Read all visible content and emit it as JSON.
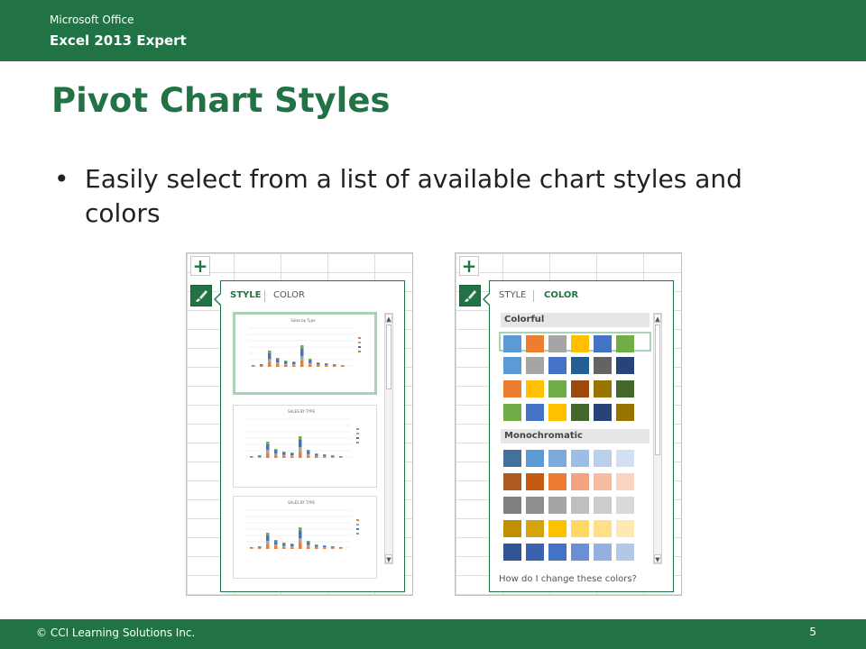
{
  "header": {
    "brand": "Microsoft Office",
    "product": "Excel 2013 Expert",
    "bg_color": "#217346"
  },
  "slide": {
    "title": "Pivot Chart Styles",
    "bullet_symbol": "•",
    "bullets": [
      "Easily select from a list of available chart styles and colors"
    ]
  },
  "style_pane": {
    "add_icon": "plus-icon",
    "brush_icon": "paintbrush-icon",
    "tabs": [
      {
        "label": "STYLE",
        "active": true
      },
      {
        "label": "COLOR",
        "active": false
      }
    ],
    "thumbnails": [
      {
        "title": "Sales by Type",
        "selected": true
      },
      {
        "title": "SALES BY TYPE",
        "selected": false
      },
      {
        "title": "SALES BY TYPE",
        "selected": false
      }
    ]
  },
  "color_pane": {
    "tabs": [
      {
        "label": "STYLE",
        "active": false
      },
      {
        "label": "COLOR",
        "active": true
      }
    ],
    "groups": [
      {
        "name": "Colorful",
        "rows": [
          [
            "#5b9bd5",
            "#ed7d31",
            "#a5a5a5",
            "#ffc000",
            "#4472c4",
            "#70ad47"
          ],
          [
            "#5b9bd5",
            "#a5a5a5",
            "#4472c4",
            "#255e91",
            "#636363",
            "#264478"
          ],
          [
            "#ed7d31",
            "#ffc000",
            "#70ad47",
            "#9e480e",
            "#997300",
            "#43682b"
          ],
          [
            "#70ad47",
            "#4472c4",
            "#ffc000",
            "#43682b",
            "#264478",
            "#997300"
          ]
        ],
        "selected_row": 0
      },
      {
        "name": "Monochromatic",
        "rows": [
          [
            "#41719c",
            "#5b9bd5",
            "#7aabdc",
            "#9ebde6",
            "#b9cfec",
            "#d3e0f3"
          ],
          [
            "#ae5a21",
            "#c55a11",
            "#ed7d31",
            "#f4a382",
            "#f7bda2",
            "#fad4c0"
          ],
          [
            "#7f7f7f",
            "#8e8e8e",
            "#a5a5a5",
            "#bfbfbf",
            "#cccccc",
            "#d9d9d9"
          ],
          [
            "#bf9000",
            "#d4a50a",
            "#ffc000",
            "#ffd966",
            "#ffe085",
            "#ffe9b3"
          ],
          [
            "#2f5597",
            "#3a62ae",
            "#4472c4",
            "#6b8fd3",
            "#95afe0",
            "#b4c7e7"
          ]
        ]
      }
    ],
    "help_text": "How do I change these colors?"
  },
  "footer": {
    "copyright": "© CCI Learning Solutions Inc.",
    "page_number": "5"
  }
}
